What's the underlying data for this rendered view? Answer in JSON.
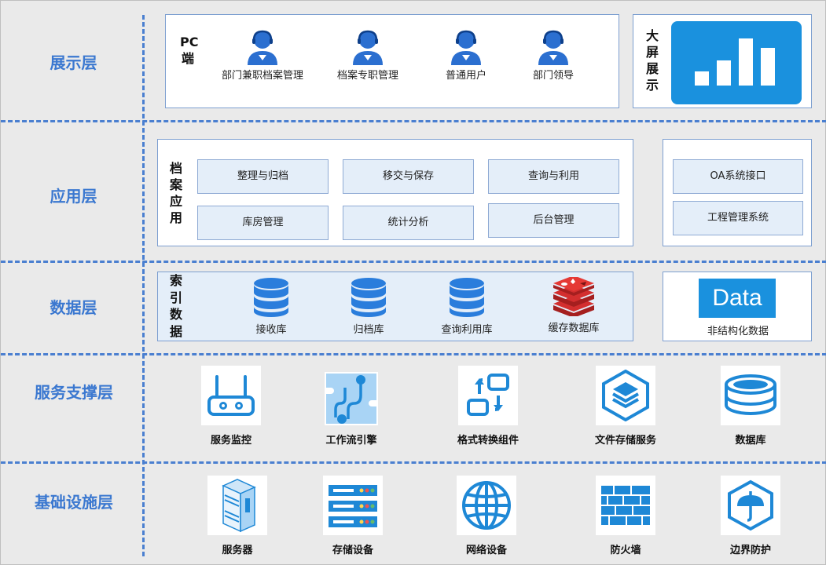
{
  "layers": {
    "presentation": "展示层",
    "application": "应用层",
    "data": "数据层",
    "service": "服务支撑层",
    "infrastructure": "基础设施层"
  },
  "presentation": {
    "pc_label": "PC端",
    "users": [
      "部门兼职档案管理",
      "档案专职管理",
      "普通用户",
      "部门领导"
    ],
    "screen_label": "大屏展示"
  },
  "application": {
    "group_label": "档案应用",
    "modules": [
      "整理与归档",
      "移交与保存",
      "查询与利用",
      "库房管理",
      "统计分析",
      "后台管理"
    ],
    "interfaces": [
      "OA系统接口",
      "工程管理系统"
    ]
  },
  "data": {
    "group_label": "索引数据",
    "databases": [
      "接收库",
      "归档库",
      "查询利用库",
      "缓存数据库"
    ],
    "unstructured_logo": "Data",
    "unstructured_label": "非结构化数据"
  },
  "service": {
    "items": [
      "服务监控",
      "工作流引擎",
      "格式转换组件",
      "文件存储服务",
      "数据库"
    ]
  },
  "infrastructure": {
    "items": [
      "服务器",
      "存储设备",
      "网络设备",
      "防火墙",
      "边界防护"
    ]
  },
  "colors": {
    "accent": "#3b78d0",
    "icon_blue": "#1e88d6",
    "screen_bg": "#1a91de",
    "redis_red": "#c62828"
  }
}
